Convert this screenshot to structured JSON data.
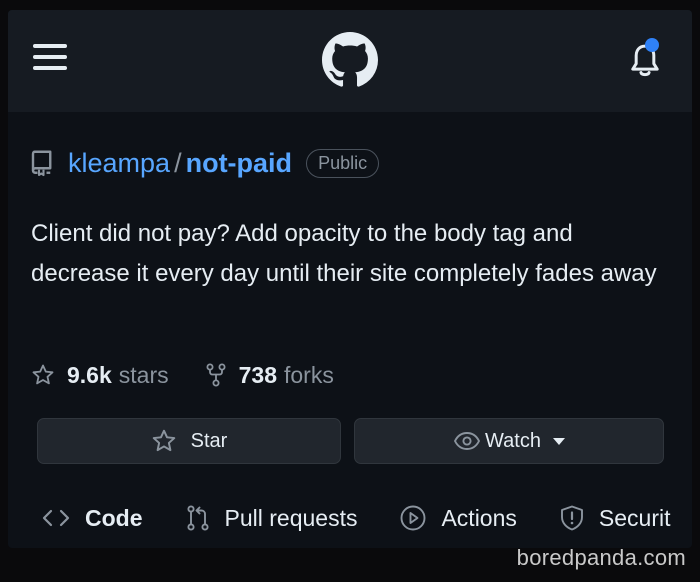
{
  "header": {
    "menu_icon": "hamburger-icon",
    "logo_icon": "github-logo",
    "notifications_icon": "bell-icon",
    "accent": "#2f81f7"
  },
  "repo": {
    "owner": "kleampa",
    "separator": "/",
    "name": "not-paid",
    "visibility": "Public",
    "description": "Client did not pay? Add opacity to the body tag and decrease it every day until their site completely fades away"
  },
  "stats": {
    "stars_count": "9.6k",
    "stars_label": "stars",
    "forks_count": "738",
    "forks_label": "forks"
  },
  "actions": {
    "star_label": "Star",
    "watch_label": "Watch"
  },
  "tabs": [
    {
      "label": "Code",
      "icon": "code-icon"
    },
    {
      "label": "Pull requests",
      "icon": "pull-request-icon"
    },
    {
      "label": "Actions",
      "icon": "play-icon"
    },
    {
      "label": "Securit",
      "icon": "shield-icon"
    }
  ],
  "watermark": "boredpanda.com",
  "colors": {
    "background": "#0d1117",
    "header_bg": "#161b22",
    "link": "#58a6ff",
    "muted": "#8b949e",
    "button_bg": "#21262d"
  }
}
